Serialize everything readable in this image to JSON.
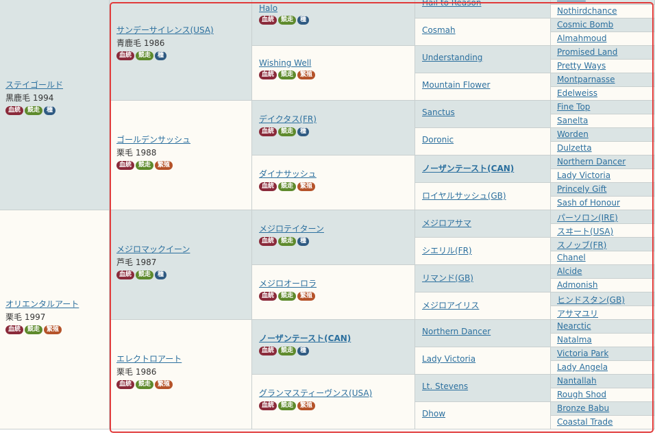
{
  "col0": [
    {
      "name": "ステイゴールド",
      "info": "黒鹿毛 1994",
      "badges": [
        "血統",
        "競走",
        "種"
      ]
    },
    {
      "name": "オリエンタルアート",
      "info": "栗毛 1997",
      "badges": [
        "血統",
        "競走",
        "繁殖"
      ]
    }
  ],
  "col1": [
    {
      "name": "サンデーサイレンス(USA)",
      "info": "青鹿毛 1986",
      "badges": [
        "血統",
        "競走",
        "種"
      ]
    },
    {
      "name": "ゴールデンサッシュ",
      "info": "栗毛 1988",
      "badges": [
        "血統",
        "競走",
        "繁殖"
      ]
    },
    {
      "name": "メジロマックイーン",
      "info": "芦毛 1987",
      "badges": [
        "血統",
        "競走",
        "種"
      ]
    },
    {
      "name": "エレクトロアート",
      "info": "栗毛 1986",
      "badges": [
        "血統",
        "競走",
        "繁殖"
      ]
    }
  ],
  "col2": [
    {
      "name": "Halo",
      "badges": [
        "血統",
        "競走",
        "種"
      ]
    },
    {
      "name": "Wishing Well",
      "badges": [
        "血統",
        "競走",
        "繁殖"
      ]
    },
    {
      "name": "デイクタス(FR)",
      "badges": [
        "血統",
        "競走",
        "種"
      ]
    },
    {
      "name": "ダイナサッシュ",
      "badges": [
        "血統",
        "競走",
        "繁殖"
      ]
    },
    {
      "name": "メジロテイターン",
      "badges": [
        "血統",
        "競走",
        "種"
      ]
    },
    {
      "name": "メジロオーロラ",
      "badges": [
        "血統",
        "競走",
        "繁殖"
      ]
    },
    {
      "name": "ノーザンテースト(CAN)",
      "badges": [
        "血統",
        "競走",
        "種"
      ],
      "bold": true
    },
    {
      "name": "グランマスティーヴンス(USA)",
      "badges": [
        "血統",
        "競走",
        "繁殖"
      ]
    }
  ],
  "col3": [
    {
      "name": "Hail to Reason"
    },
    {
      "name": "Cosmah"
    },
    {
      "name": "Understanding"
    },
    {
      "name": "Mountain Flower"
    },
    {
      "name": "Sanctus"
    },
    {
      "name": "Doronic"
    },
    {
      "name": "ノーザンテースト(CAN)",
      "bold": true
    },
    {
      "name": "ロイヤルサッシュ(GB)"
    },
    {
      "name": "メジロアサマ"
    },
    {
      "name": "シエリル(FR)"
    },
    {
      "name": "リマンド(GB)"
    },
    {
      "name": "メジロアイリス"
    },
    {
      "name": "Northern Dancer"
    },
    {
      "name": "Lady Victoria"
    },
    {
      "name": "Lt. Stevens"
    },
    {
      "name": "Dhow"
    }
  ],
  "col4": [
    "Turn-to",
    "Nothirdchance",
    "Cosmic Bomb",
    "Almahmoud",
    "Promised Land",
    "Pretty Ways",
    "Montparnasse",
    "Edelweiss",
    "Fine Top",
    "Sanelta",
    "Worden",
    "Dulzetta",
    "Northern Dancer",
    "Lady Victoria",
    "Princely Gift",
    "Sash of Honour",
    "パーソロン(IRE)",
    "スヰート(USA)",
    "スノッブ(FR)",
    "Chanel",
    "Alcide",
    "Admonish",
    "ヒンドスタン(GB)",
    "アサマユリ",
    "Nearctic",
    "Natalma",
    "Victoria Park",
    "Lady Angela",
    "Nantallah",
    "Rough Shod",
    "Bronze Babu",
    "Coastal Trade"
  ],
  "colors": {
    "frame": "#e03a3a",
    "link": "#2b6f9e",
    "gray_cell": "#dbe4e4",
    "white_cell": "#fdfbf5"
  }
}
